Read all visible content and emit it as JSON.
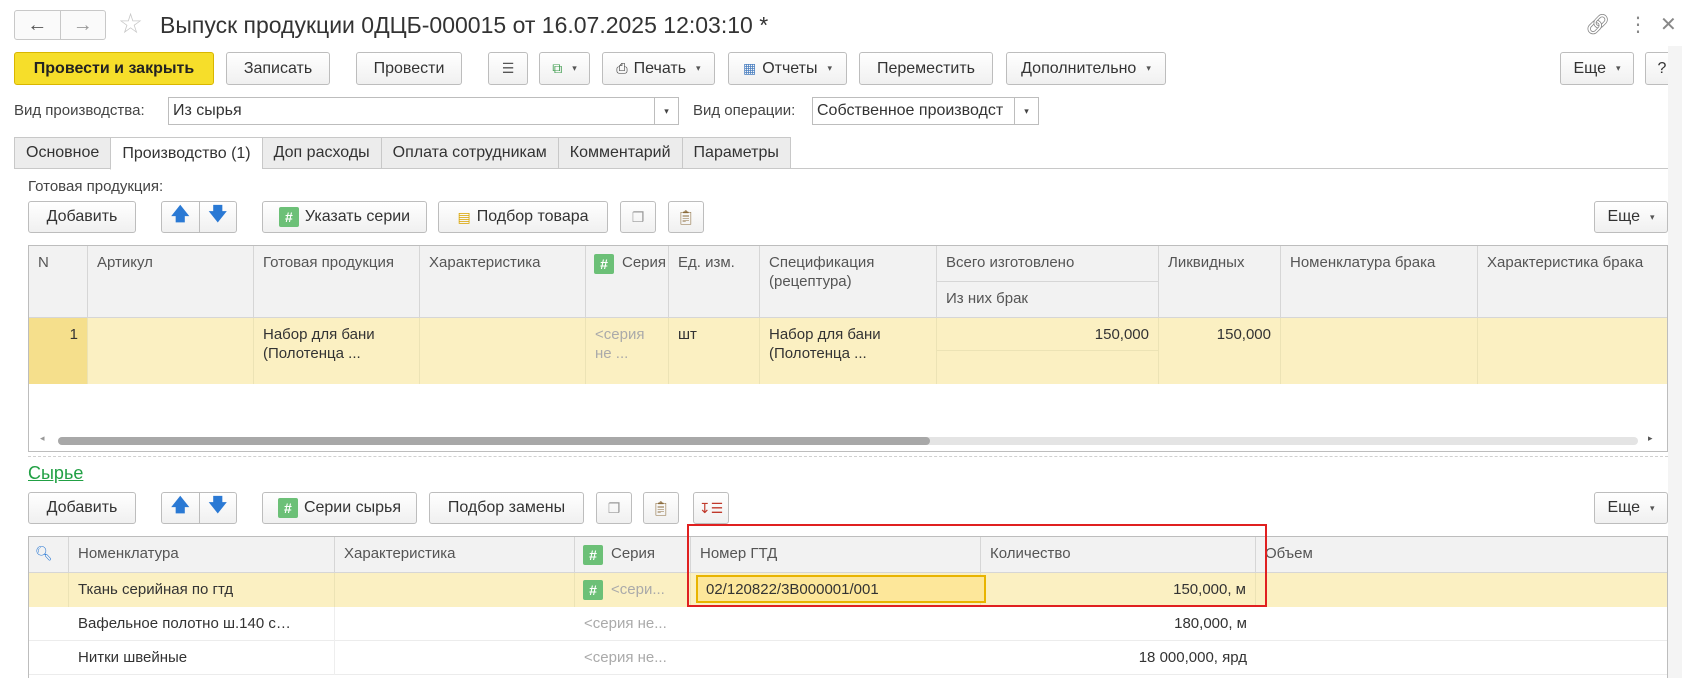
{
  "window": {
    "title": "Выпуск продукции 0ДЦБ-000015 от 16.07.2025 12:03:10 *",
    "top_icons": [
      "link-icon",
      "more-icon",
      "close-icon"
    ]
  },
  "toolbar": {
    "post_close": "Провести и закрыть",
    "save": "Записать",
    "post": "Провести",
    "print": "Печать",
    "reports": "Отчеты",
    "move": "Переместить",
    "additional": "Дополнительно",
    "more": "Еще",
    "help": "?"
  },
  "header": {
    "prod_type_label": "Вид производства:",
    "prod_type_value": "Из сырья",
    "op_type_label": "Вид операции:",
    "op_type_value": "Собственное производст"
  },
  "tabs": [
    "Основное",
    "Производство (1)",
    "Доп расходы",
    "Оплата сотрудникам",
    "Комментарий",
    "Параметры"
  ],
  "products": {
    "label": "Готовая продукция:",
    "add": "Добавить",
    "series_btn": "Указать серии",
    "pick_btn": "Подбор товара",
    "more": "Еще",
    "columns": {
      "n": "N",
      "article": "Артикул",
      "product": "Готовая продукция",
      "characteristic": "Характеристика",
      "series": "Серия",
      "unit": "Ед. изм.",
      "spec": "Спецификация (рецептура)",
      "total": "Всего изготовлено",
      "defect": "Из них брак",
      "liquid": "Ликвидных",
      "defect_nom": "Номенклатура брака",
      "defect_char": "Характеристика брака"
    },
    "rows": [
      {
        "n": "1",
        "article": "",
        "product": "Набор для бани (Полотенца ...",
        "characteristic": "",
        "series": "<серия не ...",
        "unit": "шт",
        "spec": "Набор для бани (Полотенца ...",
        "total": "150,000",
        "defect": "",
        "liquid": "150,000"
      }
    ]
  },
  "materials": {
    "title": "Сырье",
    "add": "Добавить",
    "series_btn": "Серии сырья",
    "replace_btn": "Подбор замены",
    "more": "Еще",
    "columns": {
      "nom": "Номенклатура",
      "characteristic": "Характеристика",
      "series": "Серия",
      "gtd": "Номер ГТД",
      "qty": "Количество",
      "volume": "Объем"
    },
    "rows": [
      {
        "nom": "Ткань серийная по гтд",
        "characteristic": "",
        "series": "<сери...",
        "gtd": "02/120822/3В000001/001",
        "qty": "150,000, м"
      },
      {
        "nom": "Вафельное полотно ш.140 с…",
        "characteristic": "",
        "series": "<серия не...",
        "gtd": "",
        "qty": "180,000, м"
      },
      {
        "nom": "Нитки швейные",
        "characteristic": "",
        "series": "<серия не...",
        "gtd": "",
        "qty": "18 000,000, ярд"
      }
    ]
  }
}
